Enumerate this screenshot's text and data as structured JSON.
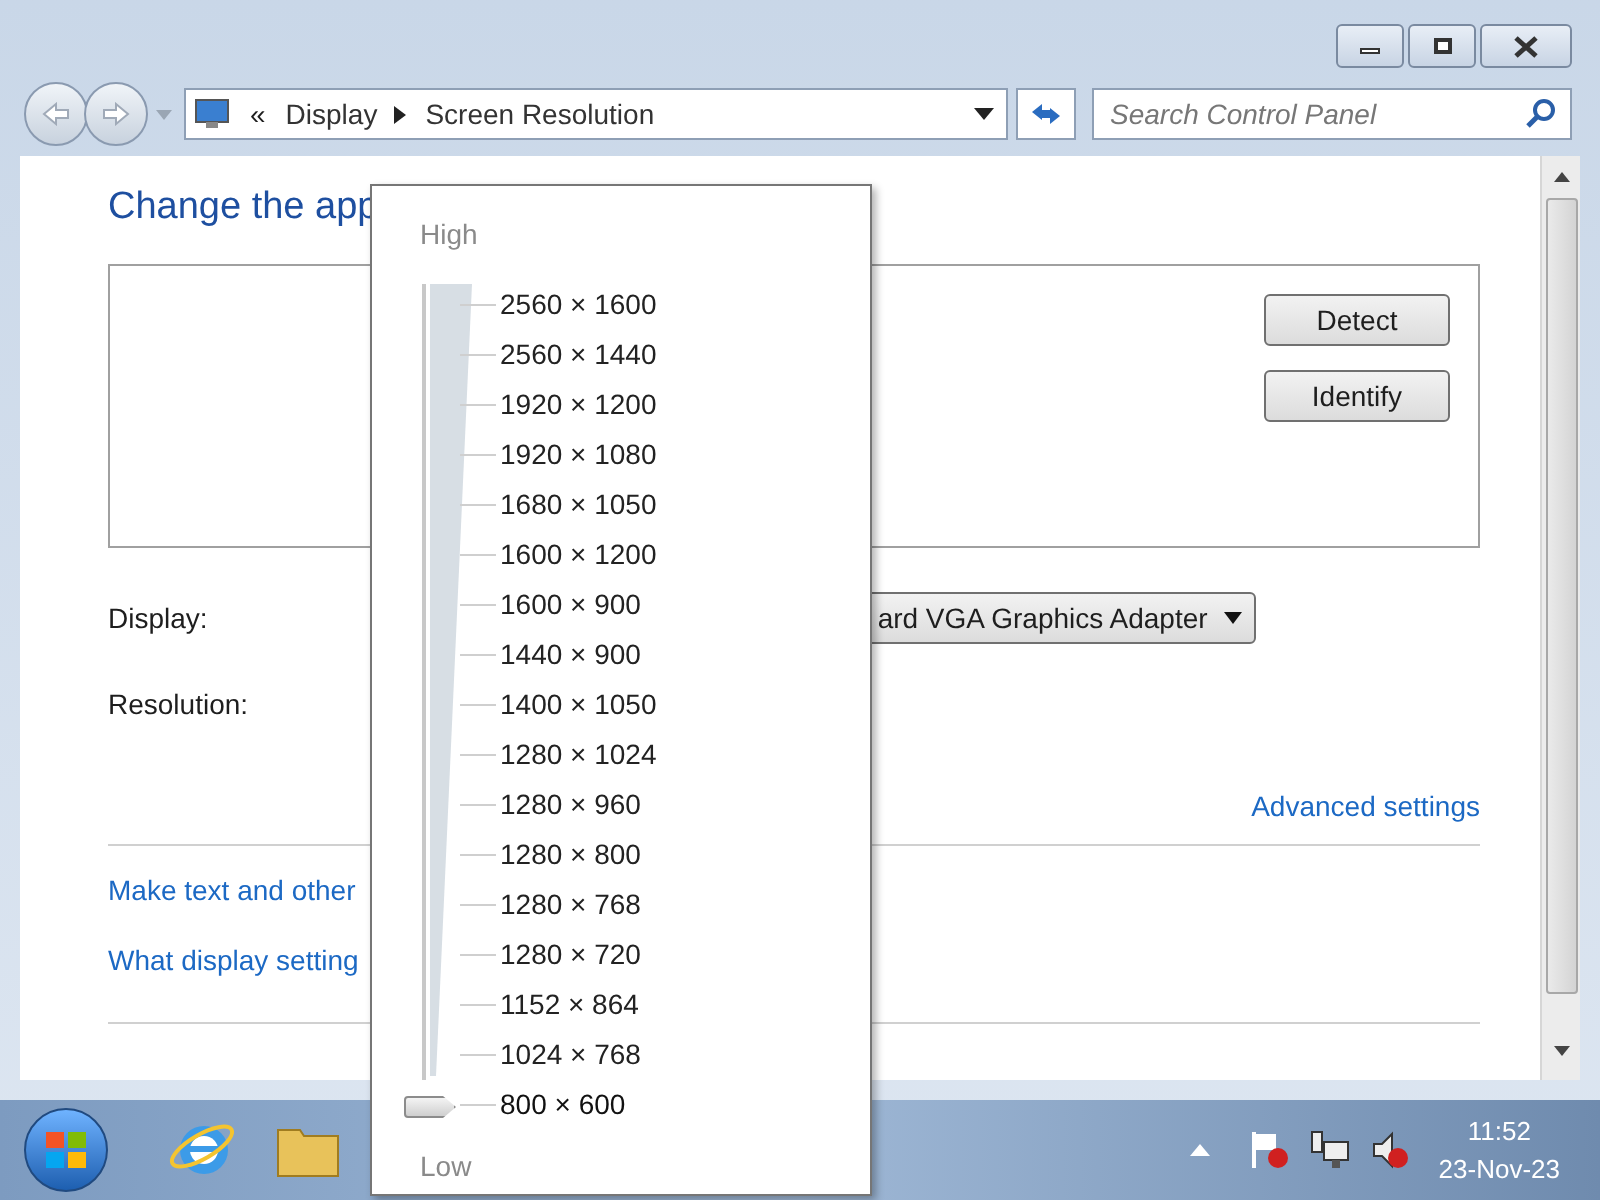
{
  "address_bar": {
    "overflow": "«",
    "crumbs": [
      "Display",
      "Screen Resolution"
    ]
  },
  "search": {
    "placeholder": "Search Control Panel"
  },
  "content": {
    "heading": "Change the app",
    "detect_button": "Detect",
    "identify_button": "Identify",
    "display_label": "Display:",
    "display_value": "ard VGA Graphics Adapter",
    "resolution_label": "Resolution:",
    "advanced_link": "Advanced settings",
    "links": [
      "Make text and other",
      "What display setting"
    ]
  },
  "resolution_popup": {
    "high": "High",
    "low": "Low",
    "options": [
      {
        "label": "2560 × 1600",
        "selected": false
      },
      {
        "label": "2560 × 1440",
        "selected": false
      },
      {
        "label": "1920 × 1200",
        "selected": false
      },
      {
        "label": "1920 × 1080",
        "selected": false
      },
      {
        "label": "1680 × 1050",
        "selected": false
      },
      {
        "label": "1600 × 1200",
        "selected": false
      },
      {
        "label": "1600 × 900",
        "selected": false
      },
      {
        "label": "1440 × 900",
        "selected": false
      },
      {
        "label": "1400 × 1050",
        "selected": false
      },
      {
        "label": "1280 × 1024",
        "selected": false
      },
      {
        "label": "1280 × 960",
        "selected": false
      },
      {
        "label": "1280 × 800",
        "selected": false
      },
      {
        "label": "1280 × 768",
        "selected": false
      },
      {
        "label": "1280 × 720",
        "selected": false
      },
      {
        "label": "1152 × 864",
        "selected": false
      },
      {
        "label": "1024 × 768",
        "selected": false
      },
      {
        "label": "800 × 600",
        "selected": true
      }
    ]
  },
  "taskbar": {
    "time": "11:52",
    "date": "23-Nov-23"
  }
}
